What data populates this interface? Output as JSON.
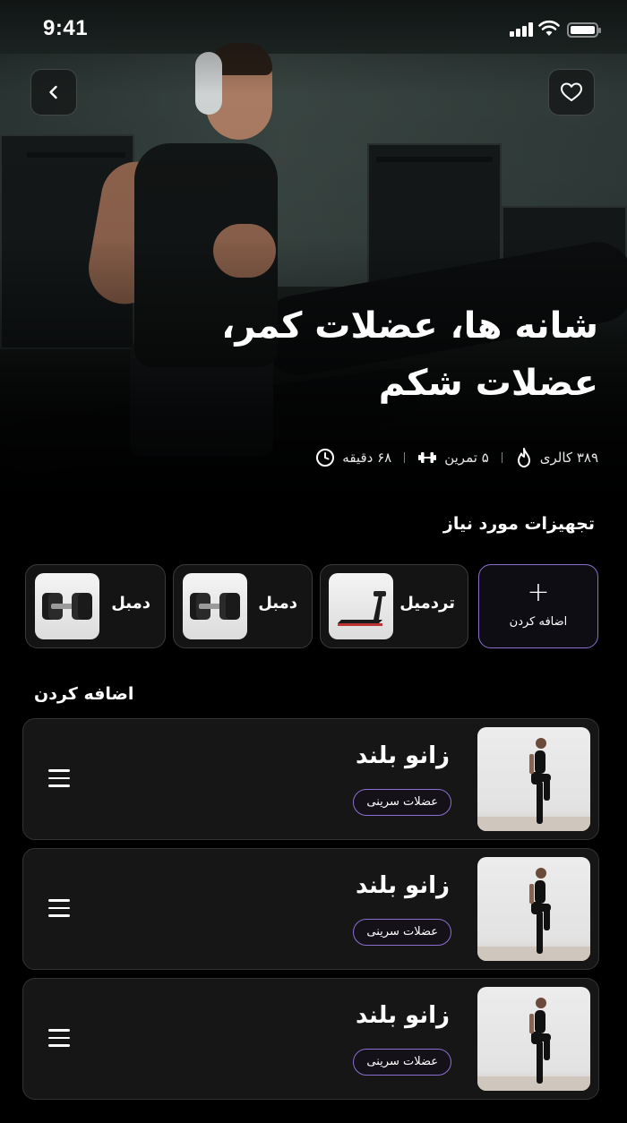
{
  "status_bar": {
    "time": "9:41"
  },
  "hero": {
    "title": "شانه ها، عضلات کمر، عضلات شکم",
    "stats": [
      {
        "icon": "flame-icon",
        "label": "۳۸۹ کالری"
      },
      {
        "icon": "dumbbell-icon",
        "label": "۵ تمرین"
      },
      {
        "icon": "clock-icon",
        "label": "۶۸ دقیقه"
      }
    ]
  },
  "equipment": {
    "title": "تجهیزات مورد نیاز",
    "add_label": "اضافه کردن",
    "items": [
      {
        "label": "تردمیل",
        "icon": "treadmill"
      },
      {
        "label": "دمبل",
        "icon": "dumbbell"
      },
      {
        "label": "دمبل",
        "icon": "dumbbell"
      }
    ]
  },
  "exercises": {
    "title": "اضافه کردن",
    "items": [
      {
        "name": "زانو بلند",
        "tag": "عضلات سرینی"
      },
      {
        "name": "زانو بلند",
        "tag": "عضلات سرینی"
      },
      {
        "name": "زانو بلند",
        "tag": "عضلات سرینی"
      }
    ]
  },
  "colors": {
    "accent": "#8a6fd1",
    "background": "#000000",
    "card": "#161616"
  }
}
